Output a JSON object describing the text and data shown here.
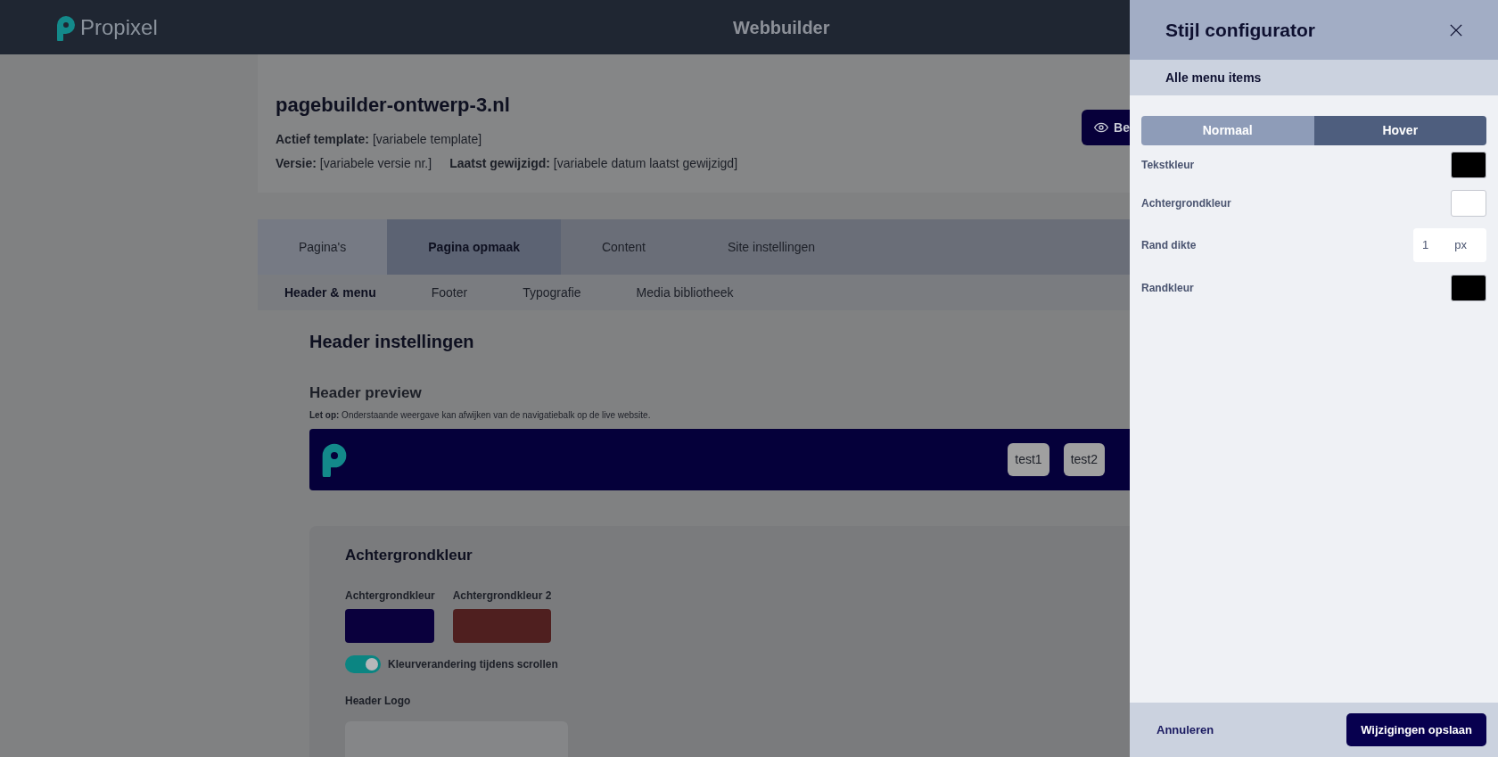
{
  "topbar": {
    "brand": "Propixel",
    "title": "Webbuilder"
  },
  "site": {
    "name": "pagebuilder-ontwerp-3.nl",
    "template_label": "Actief template:",
    "template": "[variabele template]",
    "version_label": "Versie:",
    "version": "[variabele versie nr.]",
    "modified_label": "Laatst gewijzigd:",
    "modified": "[variabele datum laatst gewijzigd]",
    "preview_button": "Be"
  },
  "tabs": [
    {
      "label": "Pagina's",
      "selected": false
    },
    {
      "label": "Pagina opmaak",
      "selected": true
    },
    {
      "label": "Content",
      "selected": false
    },
    {
      "label": "Site instellingen",
      "selected": false
    }
  ],
  "subtabs": [
    {
      "label": "Header & menu",
      "selected": true
    },
    {
      "label": "Footer",
      "selected": false
    },
    {
      "label": "Typografie",
      "selected": false
    },
    {
      "label": "Media bibliotheek",
      "selected": false
    }
  ],
  "section_title": "Header instellingen",
  "preview": {
    "title": "Header preview",
    "note": "**Let op:** Onderstaande weergave kan afwijken van de navigatiebalk op de live website.",
    "menu_items": [
      "test1",
      "test2"
    ]
  },
  "background": {
    "title": "Achtergrondkleur",
    "swatches": [
      {
        "label": "Achtergrondkleur",
        "color": "#0a003d"
      },
      {
        "label": "Achtergrondkleur 2",
        "color": "#4f1f1f"
      }
    ],
    "toggle": {
      "label": "Kleurverandering tijdens scrollen",
      "on": true
    },
    "logo_label": "Header Logo"
  },
  "panel": {
    "title": "Stijl configurator",
    "subtitle": "Alle menu items",
    "modes": [
      {
        "label": "Normaal",
        "selected": false
      },
      {
        "label": "Hover",
        "selected": true
      }
    ],
    "rows": [
      {
        "kind": "color",
        "label": "Tekstkleur",
        "color": "#000000"
      },
      {
        "kind": "color",
        "label": "Achtergrondkleur",
        "color": "#ffffff"
      },
      {
        "kind": "number",
        "label": "Rand dikte",
        "value": "1",
        "unit": "px"
      },
      {
        "kind": "color",
        "label": "Randkleur",
        "color": "#000000"
      }
    ],
    "cancel": "Annuleren",
    "save": "Wijzigingen opslaan"
  }
}
